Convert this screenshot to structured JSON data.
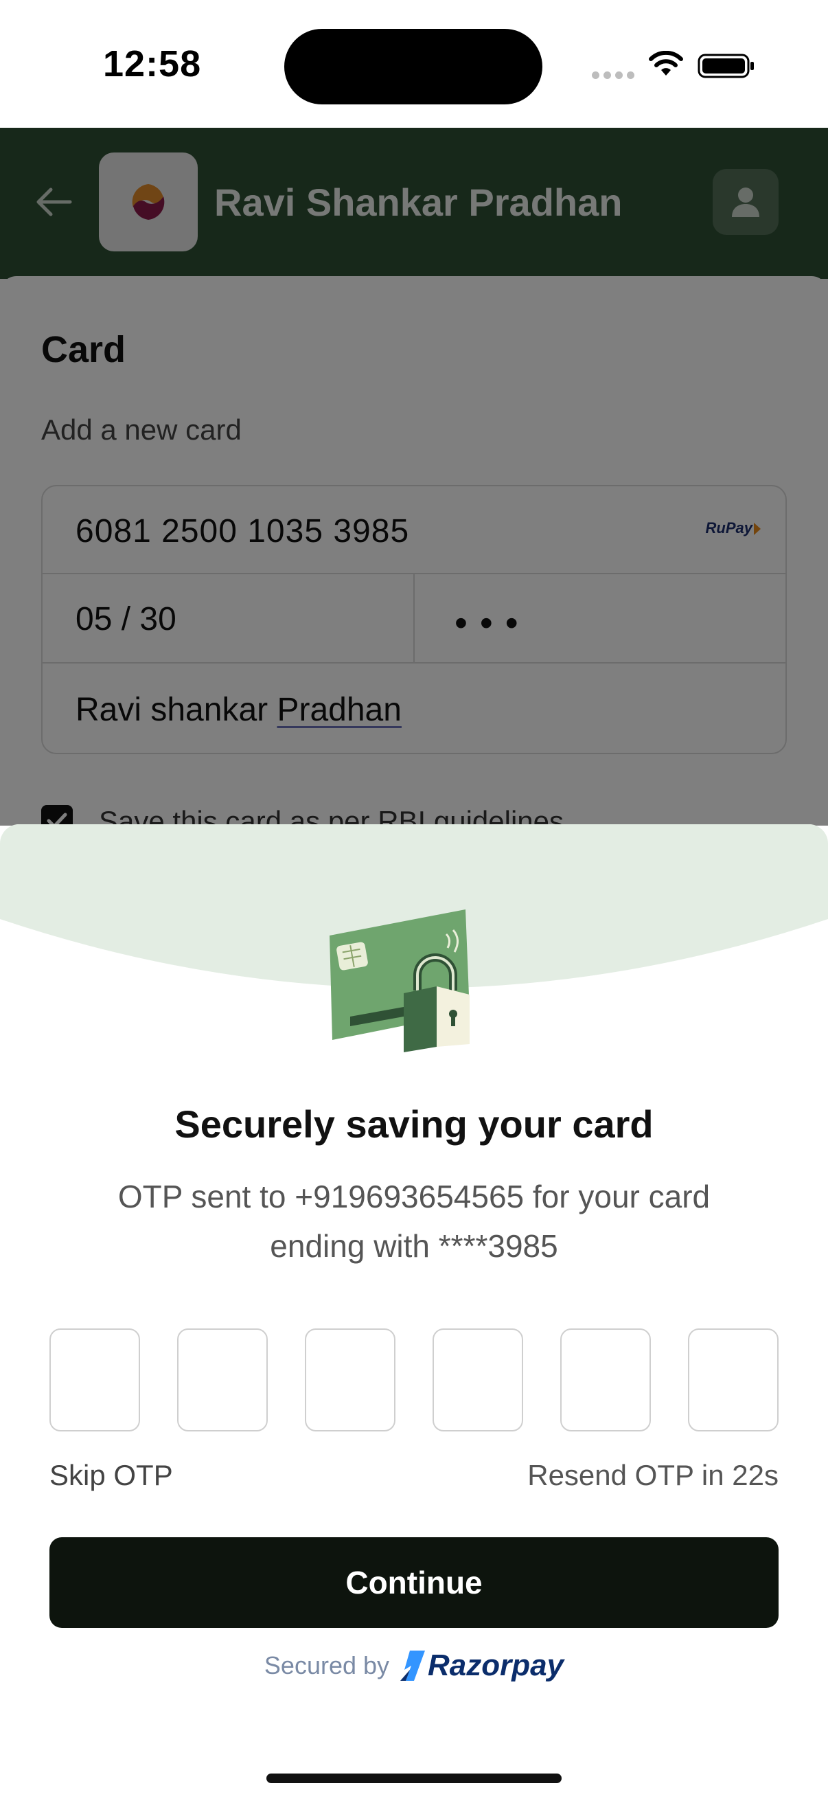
{
  "status_bar": {
    "time": "12:58"
  },
  "header": {
    "merchant_name": "Ravi Shankar Pradhan"
  },
  "card_section": {
    "title": "Card",
    "subhead": "Add a new card",
    "card_number": "6081 2500 1035 3985",
    "network": "RuPay",
    "expiry": "05 / 30",
    "cvv_mask": "•••",
    "name_first": "Ravi shankar ",
    "name_last": "Pradhan",
    "save_label": "Save this card as per RBI guidelines"
  },
  "sheet": {
    "title": "Securely saving your card",
    "description": "OTP sent to +919693654565 for your card ending with ****3985",
    "otp_digits": [
      "",
      "",
      "",
      "",
      "",
      ""
    ],
    "skip_label": "Skip OTP",
    "resend_label": "Resend OTP in 22s",
    "continue_label": "Continue",
    "secured_by_label": "Secured by",
    "provider_name": "Razorpay"
  },
  "colors": {
    "header_green": "#2f5135",
    "arc_green": "#e3ede3",
    "button_dark": "#0d140d",
    "razorpay_blue": "#0b2d6b"
  }
}
